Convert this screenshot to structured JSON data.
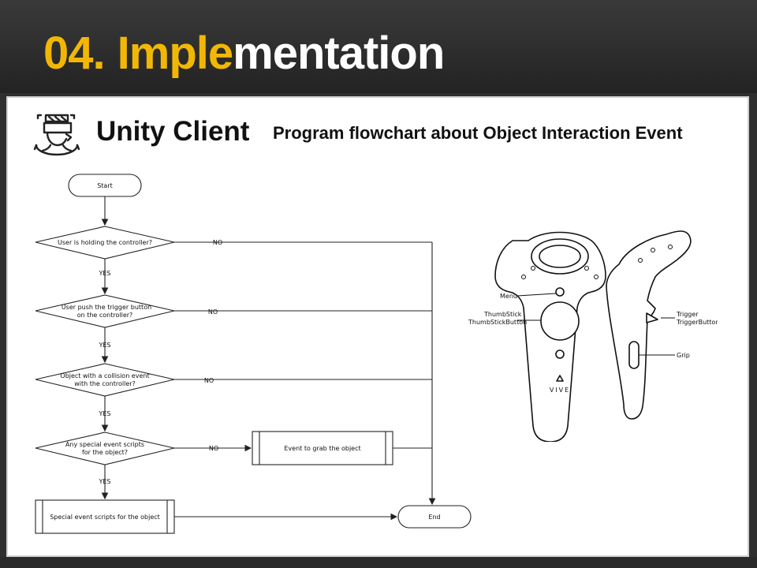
{
  "header": {
    "number": "04.",
    "title_highlight": "Imple",
    "title_rest": "mentation"
  },
  "section": {
    "icon": "vr-headset-user-icon",
    "title": "Unity Client",
    "caption": "Program flowchart about Object Interaction Event"
  },
  "flowchart": {
    "start": "Start",
    "d1": "User is holding the controller?",
    "d2_line1": "User push the trigger button",
    "d2_line2": "on the controller?",
    "d3_line1": "Object with a collision event",
    "d3_line2": "with the controller?",
    "d4_line1": "Any special event scripts",
    "d4_line2": "for the object?",
    "yes": "YES",
    "no": "NO",
    "grab": "Event to grab the object",
    "special": "Special event scripts for the object",
    "end": "End"
  },
  "controller": {
    "menu": "Menu",
    "thumbstick": "ThumbStick",
    "thumbstick_button": "ThumbStickButton",
    "brand": "VIVE",
    "trigger": "Trigger",
    "trigger_button": "TriggerButton",
    "grip": "Grip"
  },
  "colors": {
    "accent": "#f2b705",
    "background": "#2f2f2f",
    "panel": "#ffffff"
  }
}
